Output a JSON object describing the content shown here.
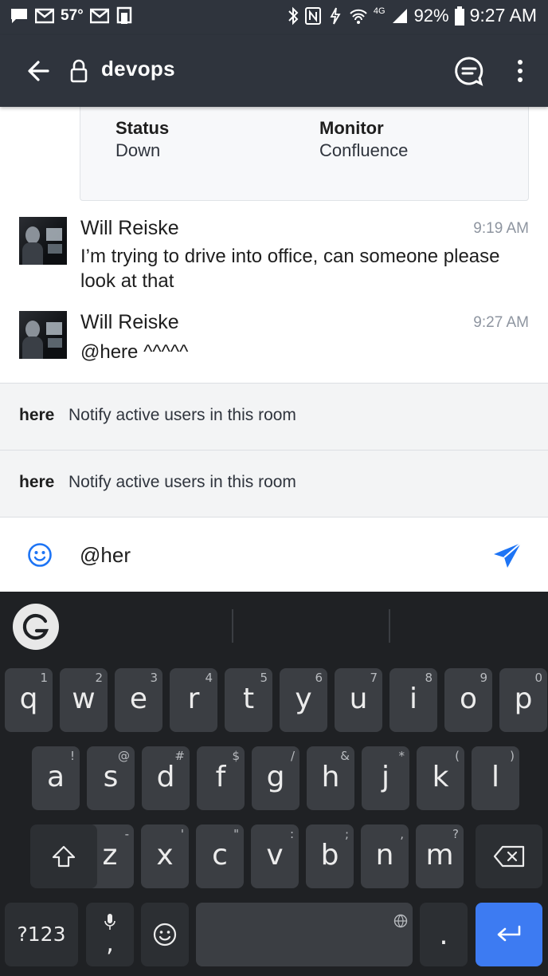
{
  "status_bar": {
    "temperature": "57°",
    "battery_pct": "92%",
    "time": "9:27 AM",
    "network": "4G"
  },
  "app_bar": {
    "room_name": "devops"
  },
  "attachment": {
    "fields": [
      {
        "label": "Status",
        "value": "Down"
      },
      {
        "label": "Monitor",
        "value": "Confluence"
      }
    ]
  },
  "messages": [
    {
      "author": "Will Reiske",
      "time": "9:19 AM",
      "text": "I’m trying to drive into office, can someone please look at that"
    },
    {
      "author": "Will Reiske",
      "time": "9:27 AM",
      "text": "@here ^^^^^"
    }
  ],
  "mention_suggestions": [
    {
      "name": "here",
      "description": "Notify active users in this room"
    },
    {
      "name": "here",
      "description": "Notify active users in this room"
    }
  ],
  "composer": {
    "value": "@her"
  },
  "keyboard": {
    "row1": [
      {
        "key": "q",
        "hint": "1"
      },
      {
        "key": "w",
        "hint": "2"
      },
      {
        "key": "e",
        "hint": "3"
      },
      {
        "key": "r",
        "hint": "4"
      },
      {
        "key": "t",
        "hint": "5"
      },
      {
        "key": "y",
        "hint": "6"
      },
      {
        "key": "u",
        "hint": "7"
      },
      {
        "key": "i",
        "hint": "8"
      },
      {
        "key": "o",
        "hint": "9"
      },
      {
        "key": "p",
        "hint": "0"
      }
    ],
    "row2": [
      {
        "key": "a",
        "hint": "!"
      },
      {
        "key": "s",
        "hint": "@"
      },
      {
        "key": "d",
        "hint": "#"
      },
      {
        "key": "f",
        "hint": "$"
      },
      {
        "key": "g",
        "hint": "/"
      },
      {
        "key": "h",
        "hint": "&"
      },
      {
        "key": "j",
        "hint": "*"
      },
      {
        "key": "k",
        "hint": "("
      },
      {
        "key": "l",
        "hint": ")"
      }
    ],
    "row3": [
      {
        "key": "z",
        "hint": "-"
      },
      {
        "key": "x",
        "hint": "'"
      },
      {
        "key": "c",
        "hint": "\""
      },
      {
        "key": "v",
        "hint": ":"
      },
      {
        "key": "b",
        "hint": ";"
      },
      {
        "key": "n",
        "hint": ","
      },
      {
        "key": "m",
        "hint": "?"
      }
    ],
    "symbols_label": "?123",
    "mic_hint": ",",
    "period_label": "."
  }
}
